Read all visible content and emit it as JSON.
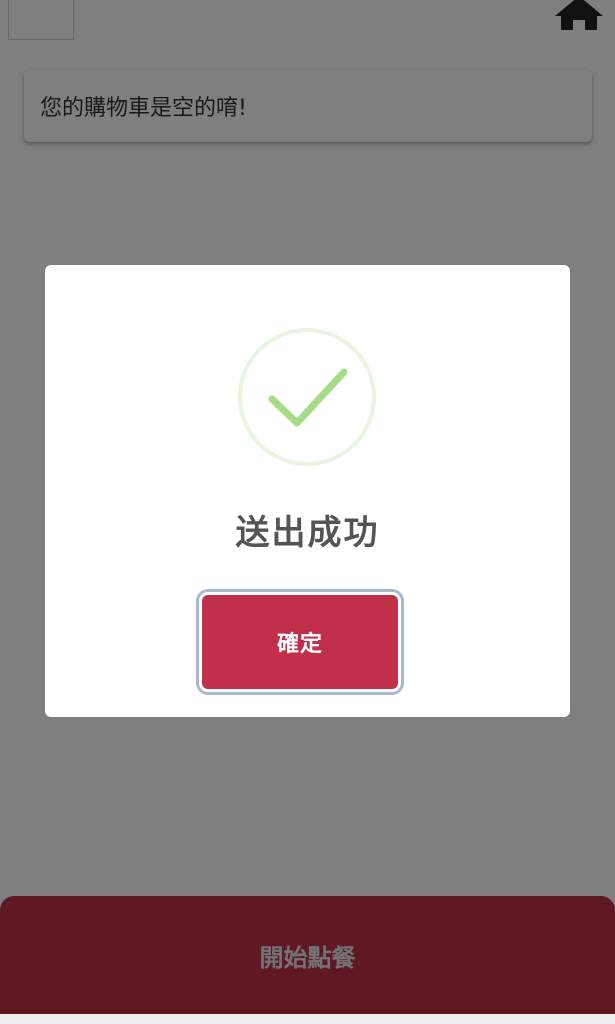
{
  "cart": {
    "empty_message": "您的購物車是空的唷!"
  },
  "bottom_bar": {
    "label": "開始點餐"
  },
  "dialog": {
    "icon": "check-icon",
    "title": "送出成功",
    "confirm_label": "確定"
  },
  "colors": {
    "brand_red": "#c0304a",
    "success_green": "#a5dc86",
    "success_ring": "#e8f5e0",
    "overlay": "rgba(0,0,0,0.5)"
  }
}
